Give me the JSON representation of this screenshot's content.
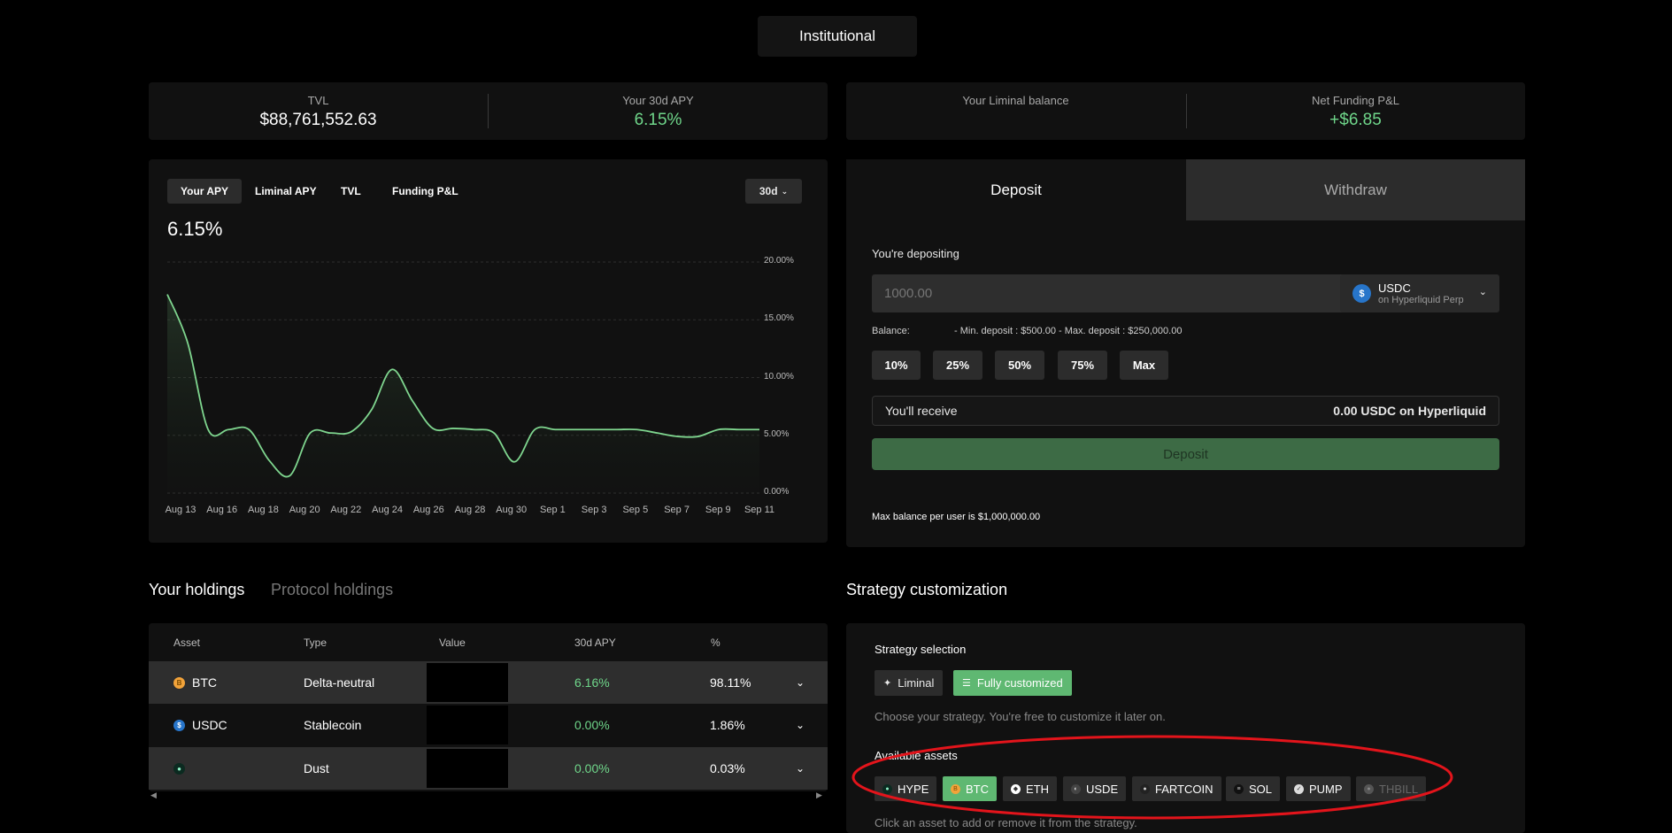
{
  "header": {
    "tab_label": "Institutional"
  },
  "stats_left": [
    {
      "label": "TVL",
      "value": "$88,761,552.63"
    },
    {
      "label": "Your 30d APY",
      "value": "6.15%"
    }
  ],
  "stats_right": [
    {
      "label": "Your Liminal balance",
      "value": ""
    },
    {
      "label": "Net Funding P&L",
      "value": "+$6.85"
    }
  ],
  "chart_panel": {
    "tabs": [
      "Your APY",
      "Liminal APY",
      "TVL",
      "Funding P&L"
    ],
    "active_tab": "Your APY",
    "range": "30d",
    "current_value": "6.15%"
  },
  "chart_data": {
    "type": "area",
    "title": "",
    "xlabel": "",
    "ylabel": "",
    "y_ticks": [
      "20.00%",
      "15.00%",
      "10.00%",
      "5.00%",
      "0.00%"
    ],
    "ylim": [
      0,
      20
    ],
    "x_ticks": [
      "Aug 13",
      "Aug 16",
      "Aug 18",
      "Aug 20",
      "Aug 22",
      "Aug 24",
      "Aug 26",
      "Aug 28",
      "Aug 30",
      "Sep 1",
      "Sep 3",
      "Sep 5",
      "Sep 7",
      "Sep 9",
      "Sep 11"
    ],
    "x": [
      "Aug 13",
      "Aug 14",
      "Aug 15",
      "Aug 16",
      "Aug 17",
      "Aug 18",
      "Aug 19",
      "Aug 20",
      "Aug 21",
      "Aug 22",
      "Aug 23",
      "Aug 24",
      "Aug 25",
      "Aug 26",
      "Aug 27",
      "Aug 28",
      "Aug 29",
      "Aug 30",
      "Aug 31",
      "Sep 1",
      "Sep 2",
      "Sep 3",
      "Sep 4",
      "Sep 5",
      "Sep 6",
      "Sep 7",
      "Sep 8",
      "Sep 9",
      "Sep 10",
      "Sep 11"
    ],
    "series": [
      {
        "values": [
          17.2,
          13.0,
          5.5,
          5.5,
          5.5,
          2.8,
          1.5,
          5.2,
          5.2,
          5.3,
          7.2,
          10.7,
          8.0,
          5.6,
          5.6,
          5.5,
          5.2,
          2.7,
          5.5,
          5.5,
          5.5,
          5.5,
          5.5,
          5.5,
          5.2,
          4.9,
          4.9,
          5.5,
          5.5,
          5.5
        ]
      }
    ],
    "line_color": "#7fd68f",
    "grid": true
  },
  "deposit": {
    "tabs": {
      "deposit": "Deposit",
      "withdraw": "Withdraw"
    },
    "active": "deposit",
    "depositing_label": "You're depositing",
    "amount_placeholder": "1000.00",
    "token": {
      "symbol": "USDC",
      "network": "on Hyperliquid Perp"
    },
    "balance_label": "Balance:",
    "limits_text": "- Min. deposit : $500.00 - Max. deposit : $250,000.00",
    "pct_buttons": [
      "10%",
      "25%",
      "50%",
      "75%",
      "Max"
    ],
    "receive_label": "You'll receive",
    "receive_value": "0.00 USDC on Hyperliquid",
    "submit_label": "Deposit",
    "max_note": "Max balance per user is $1,000,000.00"
  },
  "holdings": {
    "tabs": [
      "Your holdings",
      "Protocol holdings"
    ],
    "columns": [
      "Asset",
      "Type",
      "Value",
      "30d APY",
      "%"
    ],
    "rows": [
      {
        "asset": "BTC",
        "type": "Delta-neutral",
        "apy": "6.16%",
        "pct": "98.11%"
      },
      {
        "asset": "USDC",
        "type": "Stablecoin",
        "apy": "0.00%",
        "pct": "1.86%"
      },
      {
        "asset": "",
        "type": "Dust",
        "apy": "0.00%",
        "pct": "0.03%"
      }
    ]
  },
  "strategy": {
    "title": "Strategy customization",
    "selection_label": "Strategy selection",
    "options": [
      "Liminal",
      "Fully customized"
    ],
    "selected_option": "Fully customized",
    "help_text": "Choose your strategy. You're free to customize it later on.",
    "assets_label": "Available assets",
    "assets": [
      "HYPE",
      "BTC",
      "ETH",
      "USDE",
      "FARTCOIN",
      "SOL",
      "PUMP",
      "THBILL"
    ],
    "selected_assets": [
      "BTC"
    ],
    "disabled_assets": [
      "THBILL"
    ],
    "assets_help": "Click an asset to add or remove it from the strategy.",
    "accent_color": "#5fb872",
    "highlight_color": "#e3141b"
  }
}
